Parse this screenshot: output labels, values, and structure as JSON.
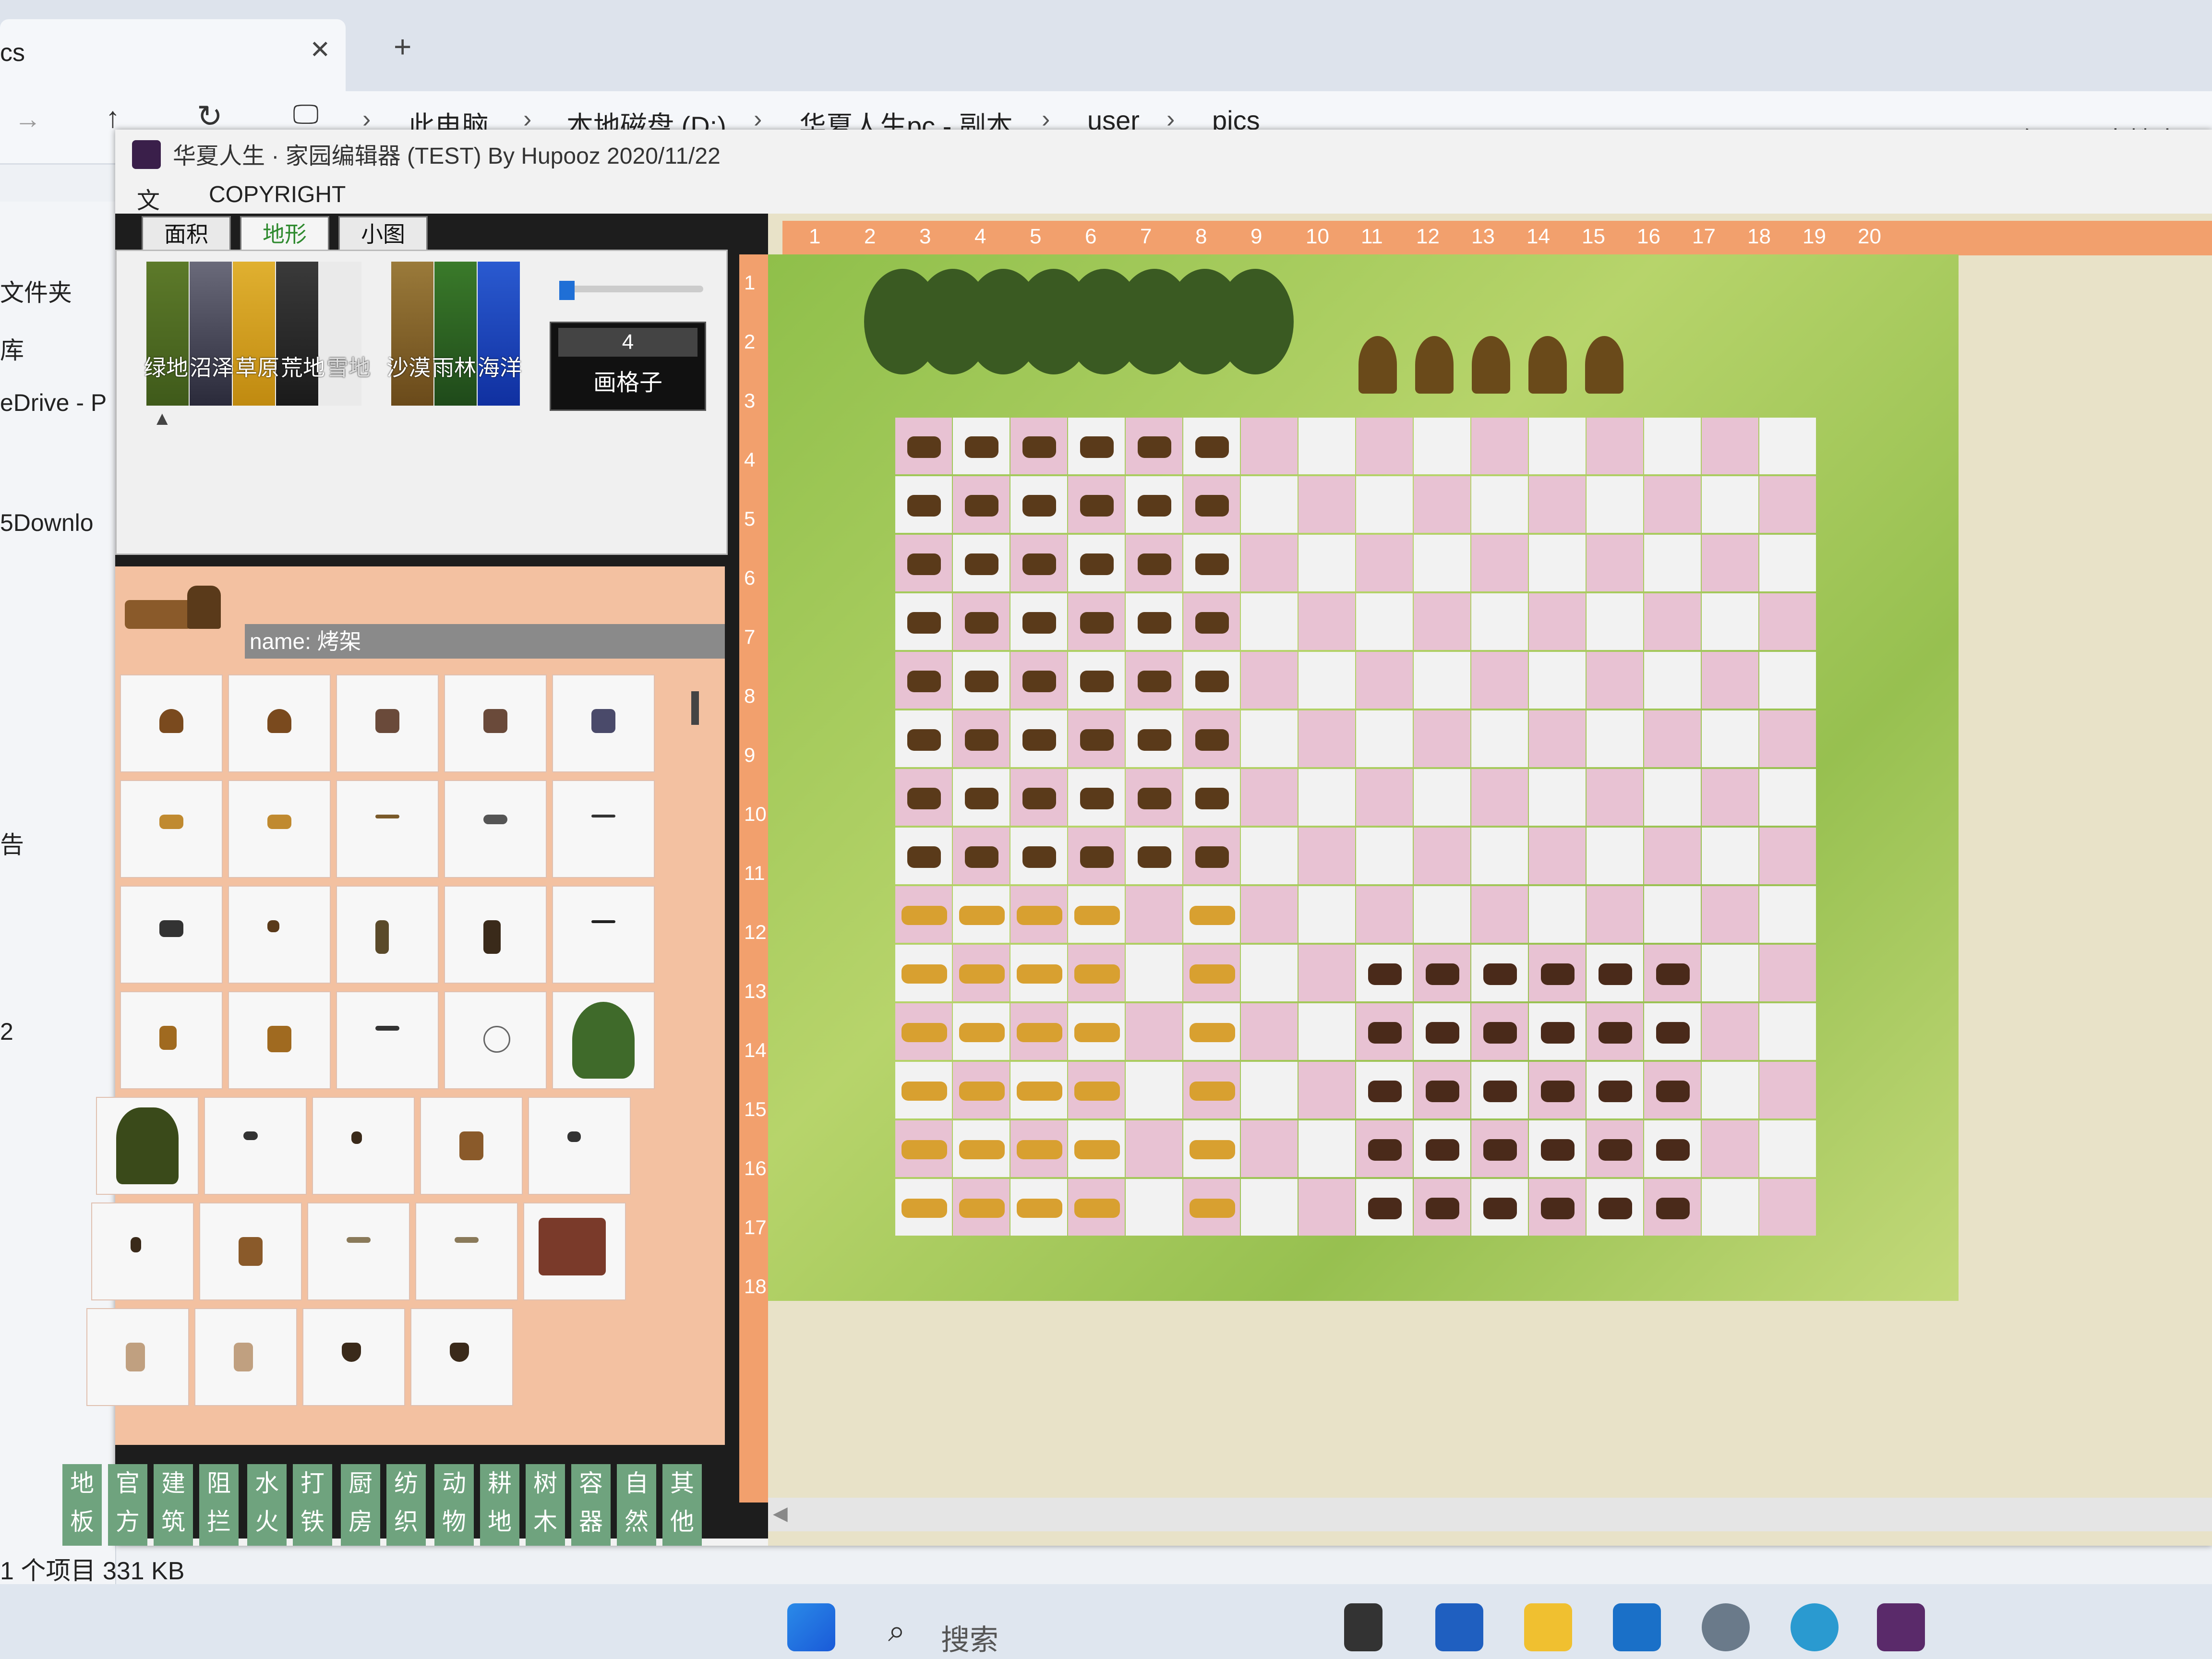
{
  "explorer": {
    "tab_close": "✕",
    "tab_add": "+",
    "tab_partial": "cs",
    "nav": {
      "up": "↑",
      "refresh": "↻",
      "monitor": "🖵"
    },
    "breadcrumbs": [
      "此电脑",
      "本地磁盘 (D:)",
      "华夏人生pc - 副本",
      "user",
      "pics"
    ],
    "search_placeholder": "在 pics 中搜索",
    "sidebar": [
      "文件夹",
      "库",
      "eDrive - P",
      "5Downlo",
      "告",
      "2"
    ],
    "status": "1 个项目  331 KB"
  },
  "editor": {
    "title": "华夏人生 · 家园编辑器 (TEST)  By Hupooz  2020/11/22",
    "menu": [
      "文件",
      "COPYRIGHT"
    ],
    "panel_tabs": [
      "面积",
      "地形",
      "小图"
    ],
    "terrain": [
      "绿地",
      "沼泽",
      "草原",
      "荒地",
      "雪地",
      "沙漠",
      "雨林",
      "海洋"
    ],
    "terrain_colors": [
      "#5d7a2a",
      "#4a4a5a",
      "#d4a423",
      "#2a2a2a",
      "#e0e0e0",
      "#8a6a2a",
      "#3a6a2a",
      "#1f3fa0"
    ],
    "grid_value": "4",
    "grid_button": "画格子",
    "name_label": "name: 烤架",
    "categories": [
      "地板",
      "官方",
      "建筑",
      "阻拦",
      "水火",
      "打铁",
      "厨房",
      "纺织",
      "动物",
      "耕地",
      "树木",
      "容器",
      "自然",
      "其他"
    ],
    "top_ruler": [
      "1",
      "2",
      "3",
      "4",
      "5",
      "6",
      "7",
      "8",
      "9",
      "10",
      "11",
      "12",
      "13",
      "14",
      "15",
      "16",
      "17",
      "18",
      "19",
      "20"
    ],
    "left_ruler": [
      "1",
      "2",
      "3",
      "4",
      "5",
      "6",
      "7",
      "8",
      "9",
      "10",
      "11",
      "12",
      "13",
      "14",
      "15",
      "16",
      "17",
      "18"
    ]
  },
  "taskbar": {
    "search": "搜索",
    "icons": [
      "start-icon",
      "search-icon",
      "taskview-icon",
      "store-icon",
      "folder-icon",
      "outlook-icon",
      "settings-icon",
      "edge-icon",
      "app-icon"
    ]
  }
}
